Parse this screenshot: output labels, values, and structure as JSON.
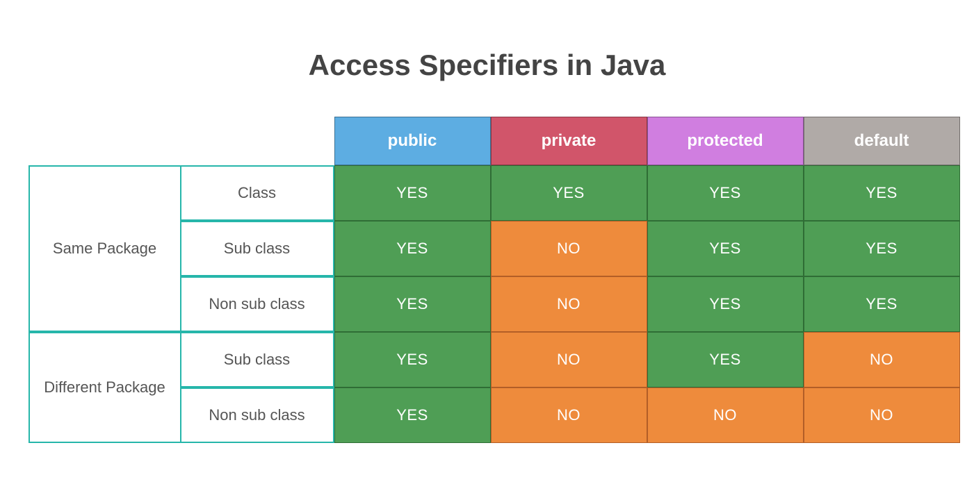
{
  "title": "Access Specifiers in Java",
  "headers": {
    "public": "public",
    "private": "private",
    "protected": "protected",
    "default": "default"
  },
  "packages": {
    "same": "Same Package",
    "different": "Different Package"
  },
  "subs": {
    "class": "Class",
    "subclass": "Sub class",
    "nonsub": "Non sub class"
  },
  "values": {
    "yes": "YES",
    "no": "NO"
  },
  "chart_data": {
    "type": "table",
    "title": "Access Specifiers in Java",
    "columns": [
      "public",
      "private",
      "protected",
      "default"
    ],
    "row_groups": [
      {
        "group": "Same Package",
        "rows": [
          {
            "label": "Class",
            "cells": [
              "YES",
              "YES",
              "YES",
              "YES"
            ]
          },
          {
            "label": "Sub class",
            "cells": [
              "YES",
              "NO",
              "YES",
              "YES"
            ]
          },
          {
            "label": "Non sub class",
            "cells": [
              "YES",
              "NO",
              "YES",
              "YES"
            ]
          }
        ]
      },
      {
        "group": "Different Package",
        "rows": [
          {
            "label": "Sub class",
            "cells": [
              "YES",
              "NO",
              "YES",
              "NO"
            ]
          },
          {
            "label": "Non sub class",
            "cells": [
              "YES",
              "NO",
              "NO",
              "NO"
            ]
          }
        ]
      }
    ]
  }
}
